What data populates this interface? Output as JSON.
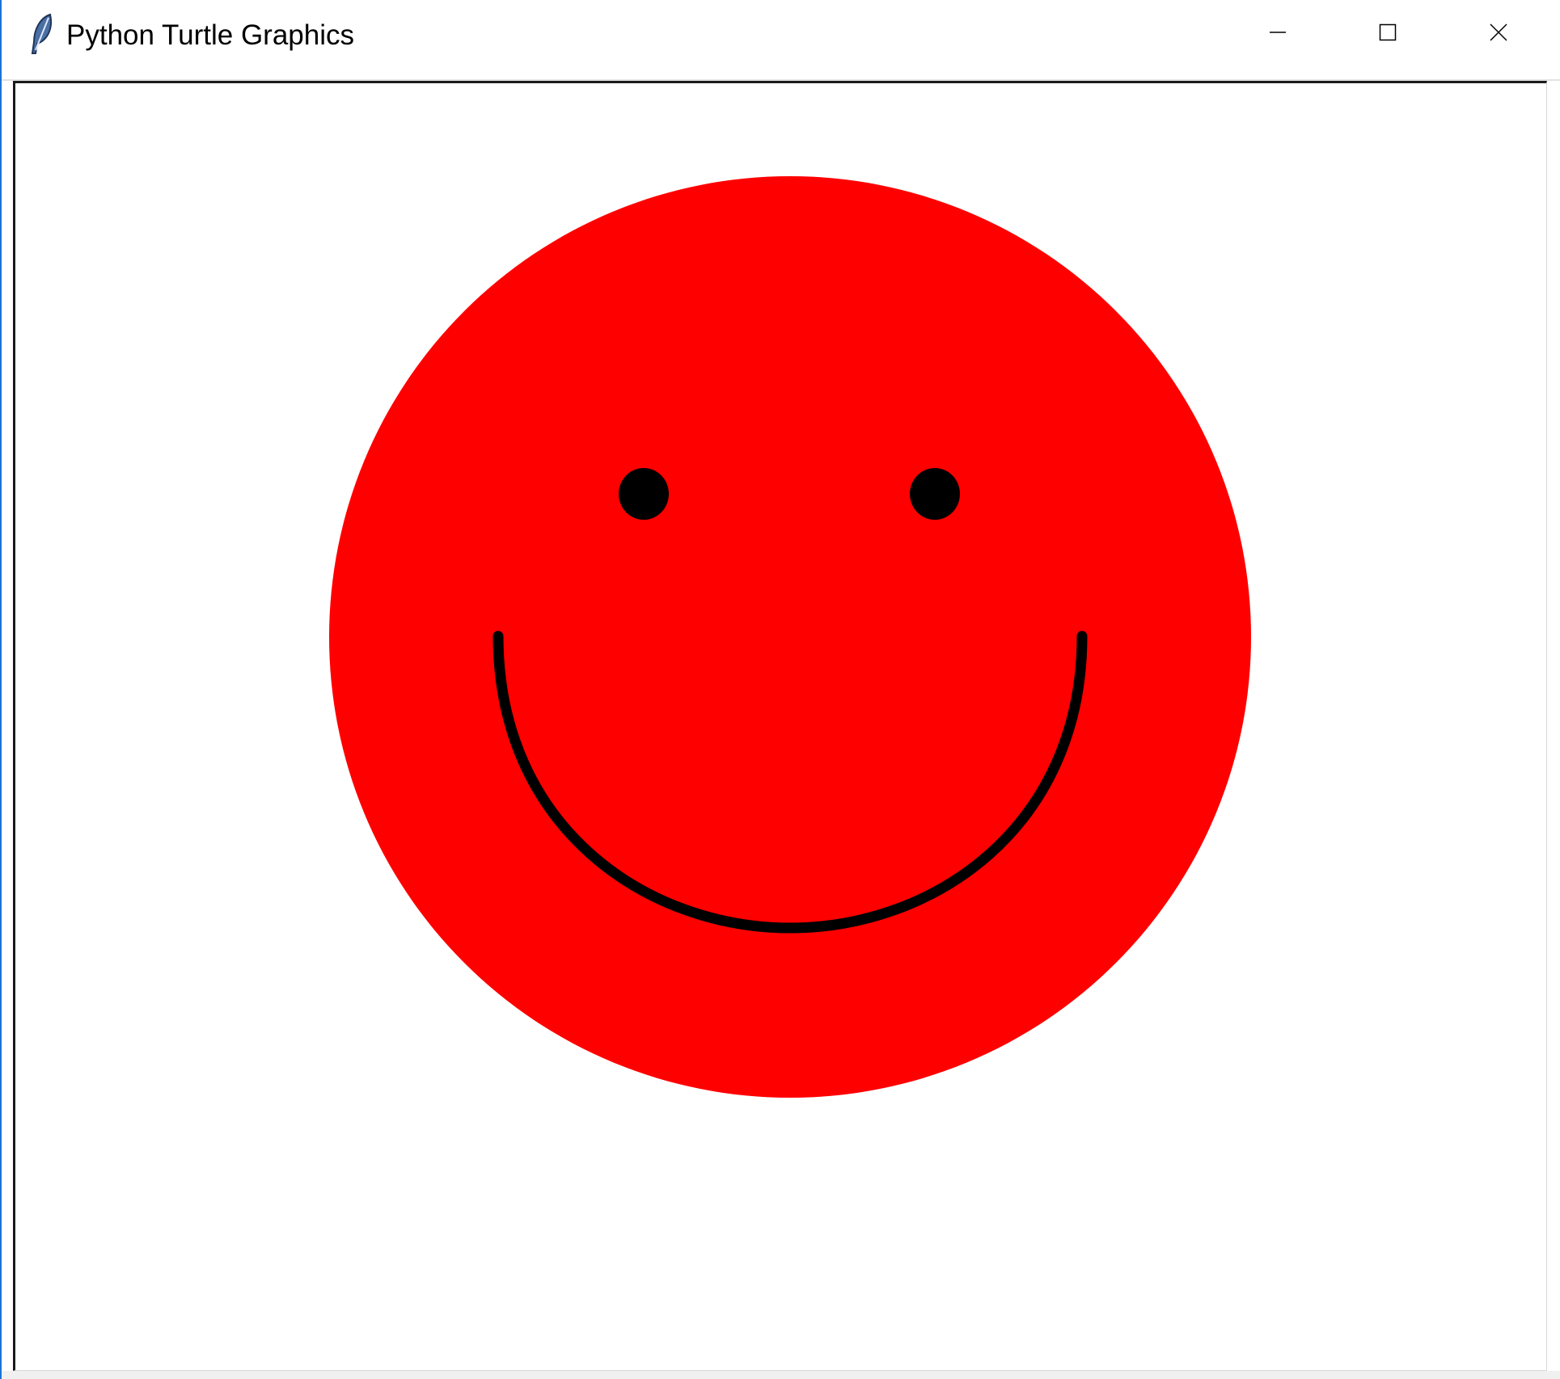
{
  "window": {
    "title": "Python Turtle Graphics",
    "icon": "feather-icon",
    "controls": {
      "minimize_icon": "minimize-icon",
      "maximize_icon": "maximize-icon",
      "close_icon": "close-icon"
    }
  },
  "canvas": {
    "background": "#ffffff",
    "face_color": "#ff0000",
    "feature_color": "#000000"
  }
}
